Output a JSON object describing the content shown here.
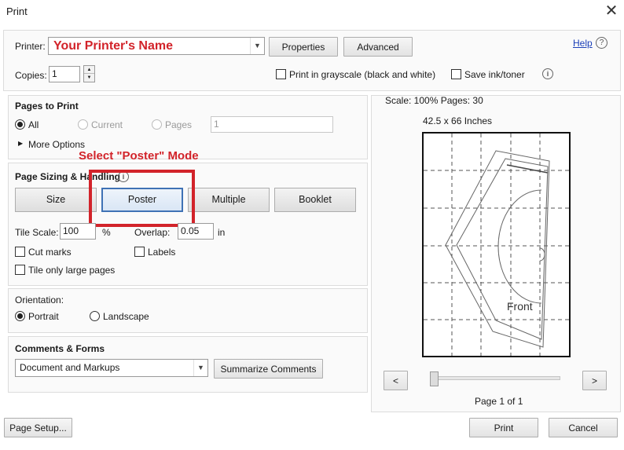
{
  "window": {
    "title": "Print",
    "close_glyph": "✕"
  },
  "printer": {
    "label": "Printer:",
    "value": "Your Printer's Name",
    "properties_label": "Properties",
    "advanced_label": "Advanced",
    "help_label": "Help",
    "value_color": "#d2232a"
  },
  "copies": {
    "label": "Copies:",
    "value": "1"
  },
  "options": {
    "grayscale_label": "Print in grayscale (black and white)",
    "save_ink_label": "Save ink/toner"
  },
  "pages_to_print": {
    "title": "Pages to Print",
    "all_label": "All",
    "current_label": "Current",
    "pages_label": "Pages",
    "pages_value": "1",
    "more_options_label": "More Options"
  },
  "annotation": {
    "text": "Select \"Poster\" Mode",
    "color": "#d2232a"
  },
  "page_sizing": {
    "title": "Page Sizing & Handling",
    "size_label": "Size",
    "poster_label": "Poster",
    "multiple_label": "Multiple",
    "booklet_label": "Booklet",
    "tile_scale_label": "Tile Scale:",
    "tile_scale_value": "100",
    "tile_scale_unit": "%",
    "overlap_label": "Overlap:",
    "overlap_value": "0.05",
    "overlap_unit": "in",
    "cut_marks_label": "Cut marks",
    "labels_label": "Labels",
    "tile_large_label": "Tile only large pages"
  },
  "orientation": {
    "title": "Orientation:",
    "portrait_label": "Portrait",
    "landscape_label": "Landscape"
  },
  "comments_forms": {
    "title": "Comments & Forms",
    "selected": "Document and Markups",
    "summarize_label": "Summarize Comments"
  },
  "preview": {
    "scale_text": "Scale: 100% Pages: 30",
    "size_text": "42.5 x 66 Inches",
    "page_text": "Front",
    "prev_label": "<",
    "next_label": ">",
    "page_indicator": "Page 1 of 1",
    "slider_value": 0
  },
  "footer": {
    "page_setup_label": "Page Setup...",
    "print_label": "Print",
    "cancel_label": "Cancel"
  }
}
